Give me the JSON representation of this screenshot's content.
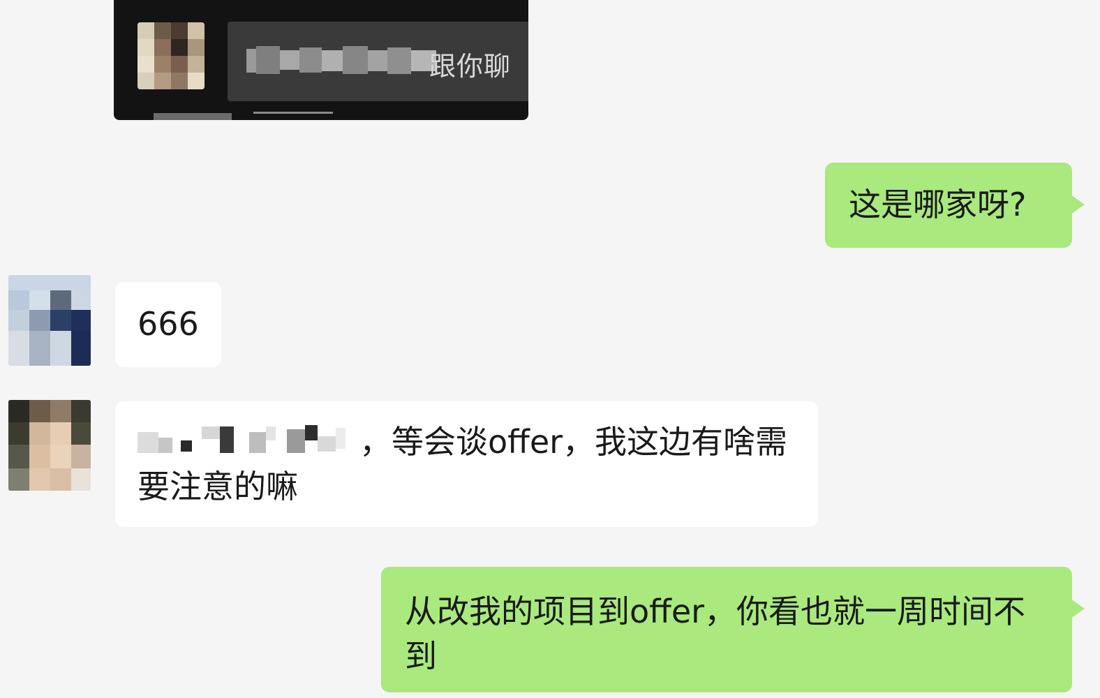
{
  "shared_card": {
    "visible_text": "跟你聊"
  },
  "messages": [
    {
      "side": "right",
      "text": "这是哪家呀?"
    },
    {
      "side": "left",
      "text": "666"
    },
    {
      "side": "left",
      "text_line1": "，等会谈offer，我这边有啥需",
      "text_line2": "要注意的嘛"
    },
    {
      "side": "right",
      "text_line1": "从改我的项目到offer，你看也就一周时间不",
      "text_line2": "到"
    }
  ],
  "colors": {
    "background": "#f5f5f5",
    "bubble_sent": "#a9e97e",
    "bubble_received": "#ffffff",
    "card_background": "#131313"
  }
}
